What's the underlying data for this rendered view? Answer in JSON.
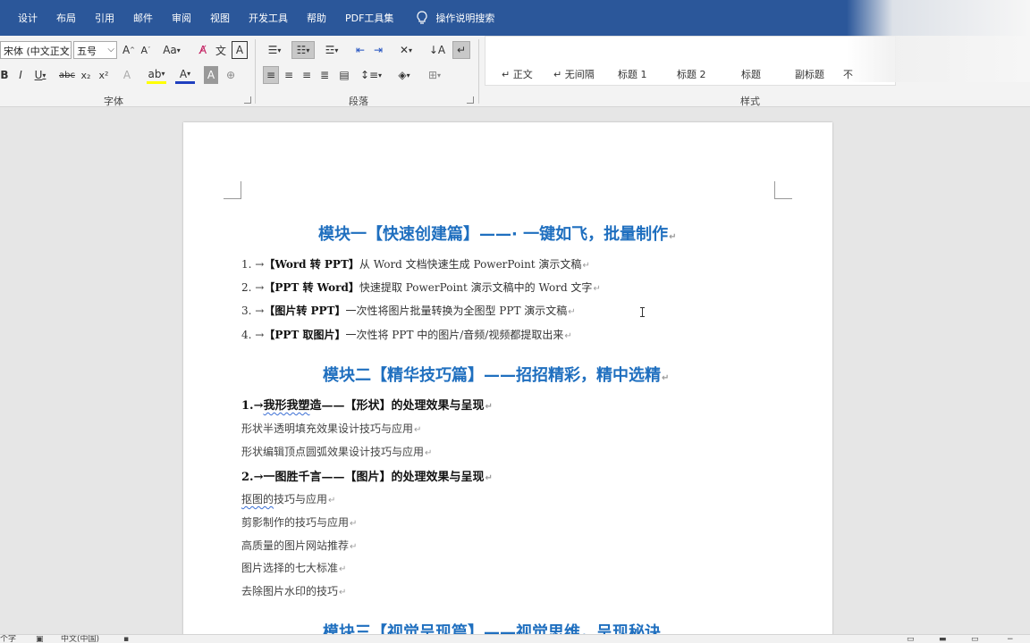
{
  "menu": {
    "items": [
      "设计",
      "布局",
      "引用",
      "邮件",
      "审阅",
      "视图",
      "开发工具",
      "帮助",
      "PDF工具集"
    ],
    "search_label": "操作说明搜索"
  },
  "ribbon": {
    "font_name": "宋体 (中文正文)",
    "font_size": "五号",
    "group_font": "字体",
    "group_paragraph": "段落",
    "group_styles": "样式",
    "styles": [
      "↵ 正文",
      "↵ 无间隔",
      "标题 1",
      "标题 2",
      "标题",
      "副标题",
      "不"
    ],
    "accent_color": "#2b579a"
  },
  "document": {
    "heading1": "模块一【快速创建篇】——· 一键如飞，批量制作",
    "list1": [
      {
        "num": "1. →",
        "bold": "【Word 转 PPT】",
        "text": "从 Word 文档快速生成 PowerPoint 演示文稿"
      },
      {
        "num": "2. →",
        "bold": "【PPT 转 Word】",
        "text": "快速提取 PowerPoint 演示文稿中的 Word 文字"
      },
      {
        "num": "3. →",
        "bold": "【图片转 PPT】",
        "text": "一次性将图片批量转换为全图型 PPT 演示文稿"
      },
      {
        "num": "4. →",
        "bold": "【PPT 取图片】",
        "text": "一次性将 PPT 中的图片/音频/视频都提取出来"
      }
    ],
    "heading2": "模块二【精华技巧篇】——招招精彩，精中选精",
    "sec1_num": "1.→",
    "sec1_squiggle": "我形我塑",
    "sec1_rest": "造——【形状】的处理效果与呈现",
    "sec1_items": [
      "形状半透明填充效果设计技巧与应用",
      "形状编辑顶点圆弧效果设计技巧与应用"
    ],
    "sec2_title": "2.→一图胜千言——【图片】的处理效果与呈现",
    "sec2_first_squiggle": "抠图的",
    "sec2_first_rest": "技巧与应用",
    "sec2_items": [
      "剪影制作的技巧与应用",
      "高质量的图片网站推荐",
      "图片选择的七大标准",
      "去除图片水印的技巧"
    ],
    "heading3": "模块三【视觉呈现篇】——视觉思维，呈现秘诀",
    "para_mark": "↵",
    "heading_color": "#1f6fbf"
  },
  "status": {
    "left": "个字",
    "lang": "中文(中国)"
  }
}
